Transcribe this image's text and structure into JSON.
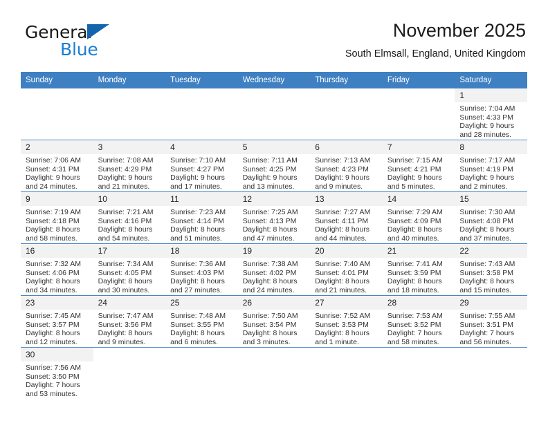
{
  "logo": {
    "word1": "General",
    "word2": "Blue",
    "triangle_color": "#1565ad",
    "blue_color": "#1a7fd4"
  },
  "header": {
    "title": "November 2025",
    "subtitle": "South Elmsall, England, United Kingdom"
  },
  "colors": {
    "header_bar": "#3f80c2",
    "row_divider": "#4a86c5",
    "daynum_bg": "#f2f2f2"
  },
  "weekday_headers": [
    "Sunday",
    "Monday",
    "Tuesday",
    "Wednesday",
    "Thursday",
    "Friday",
    "Saturday"
  ],
  "weeks": [
    [
      {
        "blank": true
      },
      {
        "blank": true
      },
      {
        "blank": true
      },
      {
        "blank": true
      },
      {
        "blank": true
      },
      {
        "blank": true
      },
      {
        "day": "1",
        "sunrise": "Sunrise: 7:04 AM",
        "sunset": "Sunset: 4:33 PM",
        "daylight1": "Daylight: 9 hours",
        "daylight2": "and 28 minutes."
      }
    ],
    [
      {
        "day": "2",
        "sunrise": "Sunrise: 7:06 AM",
        "sunset": "Sunset: 4:31 PM",
        "daylight1": "Daylight: 9 hours",
        "daylight2": "and 24 minutes."
      },
      {
        "day": "3",
        "sunrise": "Sunrise: 7:08 AM",
        "sunset": "Sunset: 4:29 PM",
        "daylight1": "Daylight: 9 hours",
        "daylight2": "and 21 minutes."
      },
      {
        "day": "4",
        "sunrise": "Sunrise: 7:10 AM",
        "sunset": "Sunset: 4:27 PM",
        "daylight1": "Daylight: 9 hours",
        "daylight2": "and 17 minutes."
      },
      {
        "day": "5",
        "sunrise": "Sunrise: 7:11 AM",
        "sunset": "Sunset: 4:25 PM",
        "daylight1": "Daylight: 9 hours",
        "daylight2": "and 13 minutes."
      },
      {
        "day": "6",
        "sunrise": "Sunrise: 7:13 AM",
        "sunset": "Sunset: 4:23 PM",
        "daylight1": "Daylight: 9 hours",
        "daylight2": "and 9 minutes."
      },
      {
        "day": "7",
        "sunrise": "Sunrise: 7:15 AM",
        "sunset": "Sunset: 4:21 PM",
        "daylight1": "Daylight: 9 hours",
        "daylight2": "and 5 minutes."
      },
      {
        "day": "8",
        "sunrise": "Sunrise: 7:17 AM",
        "sunset": "Sunset: 4:19 PM",
        "daylight1": "Daylight: 9 hours",
        "daylight2": "and 2 minutes."
      }
    ],
    [
      {
        "day": "9",
        "sunrise": "Sunrise: 7:19 AM",
        "sunset": "Sunset: 4:18 PM",
        "daylight1": "Daylight: 8 hours",
        "daylight2": "and 58 minutes."
      },
      {
        "day": "10",
        "sunrise": "Sunrise: 7:21 AM",
        "sunset": "Sunset: 4:16 PM",
        "daylight1": "Daylight: 8 hours",
        "daylight2": "and 54 minutes."
      },
      {
        "day": "11",
        "sunrise": "Sunrise: 7:23 AM",
        "sunset": "Sunset: 4:14 PM",
        "daylight1": "Daylight: 8 hours",
        "daylight2": "and 51 minutes."
      },
      {
        "day": "12",
        "sunrise": "Sunrise: 7:25 AM",
        "sunset": "Sunset: 4:13 PM",
        "daylight1": "Daylight: 8 hours",
        "daylight2": "and 47 minutes."
      },
      {
        "day": "13",
        "sunrise": "Sunrise: 7:27 AM",
        "sunset": "Sunset: 4:11 PM",
        "daylight1": "Daylight: 8 hours",
        "daylight2": "and 44 minutes."
      },
      {
        "day": "14",
        "sunrise": "Sunrise: 7:29 AM",
        "sunset": "Sunset: 4:09 PM",
        "daylight1": "Daylight: 8 hours",
        "daylight2": "and 40 minutes."
      },
      {
        "day": "15",
        "sunrise": "Sunrise: 7:30 AM",
        "sunset": "Sunset: 4:08 PM",
        "daylight1": "Daylight: 8 hours",
        "daylight2": "and 37 minutes."
      }
    ],
    [
      {
        "day": "16",
        "sunrise": "Sunrise: 7:32 AM",
        "sunset": "Sunset: 4:06 PM",
        "daylight1": "Daylight: 8 hours",
        "daylight2": "and 34 minutes."
      },
      {
        "day": "17",
        "sunrise": "Sunrise: 7:34 AM",
        "sunset": "Sunset: 4:05 PM",
        "daylight1": "Daylight: 8 hours",
        "daylight2": "and 30 minutes."
      },
      {
        "day": "18",
        "sunrise": "Sunrise: 7:36 AM",
        "sunset": "Sunset: 4:03 PM",
        "daylight1": "Daylight: 8 hours",
        "daylight2": "and 27 minutes."
      },
      {
        "day": "19",
        "sunrise": "Sunrise: 7:38 AM",
        "sunset": "Sunset: 4:02 PM",
        "daylight1": "Daylight: 8 hours",
        "daylight2": "and 24 minutes."
      },
      {
        "day": "20",
        "sunrise": "Sunrise: 7:40 AM",
        "sunset": "Sunset: 4:01 PM",
        "daylight1": "Daylight: 8 hours",
        "daylight2": "and 21 minutes."
      },
      {
        "day": "21",
        "sunrise": "Sunrise: 7:41 AM",
        "sunset": "Sunset: 3:59 PM",
        "daylight1": "Daylight: 8 hours",
        "daylight2": "and 18 minutes."
      },
      {
        "day": "22",
        "sunrise": "Sunrise: 7:43 AM",
        "sunset": "Sunset: 3:58 PM",
        "daylight1": "Daylight: 8 hours",
        "daylight2": "and 15 minutes."
      }
    ],
    [
      {
        "day": "23",
        "sunrise": "Sunrise: 7:45 AM",
        "sunset": "Sunset: 3:57 PM",
        "daylight1": "Daylight: 8 hours",
        "daylight2": "and 12 minutes."
      },
      {
        "day": "24",
        "sunrise": "Sunrise: 7:47 AM",
        "sunset": "Sunset: 3:56 PM",
        "daylight1": "Daylight: 8 hours",
        "daylight2": "and 9 minutes."
      },
      {
        "day": "25",
        "sunrise": "Sunrise: 7:48 AM",
        "sunset": "Sunset: 3:55 PM",
        "daylight1": "Daylight: 8 hours",
        "daylight2": "and 6 minutes."
      },
      {
        "day": "26",
        "sunrise": "Sunrise: 7:50 AM",
        "sunset": "Sunset: 3:54 PM",
        "daylight1": "Daylight: 8 hours",
        "daylight2": "and 3 minutes."
      },
      {
        "day": "27",
        "sunrise": "Sunrise: 7:52 AM",
        "sunset": "Sunset: 3:53 PM",
        "daylight1": "Daylight: 8 hours",
        "daylight2": "and 1 minute."
      },
      {
        "day": "28",
        "sunrise": "Sunrise: 7:53 AM",
        "sunset": "Sunset: 3:52 PM",
        "daylight1": "Daylight: 7 hours",
        "daylight2": "and 58 minutes."
      },
      {
        "day": "29",
        "sunrise": "Sunrise: 7:55 AM",
        "sunset": "Sunset: 3:51 PM",
        "daylight1": "Daylight: 7 hours",
        "daylight2": "and 56 minutes."
      }
    ],
    [
      {
        "day": "30",
        "sunrise": "Sunrise: 7:56 AM",
        "sunset": "Sunset: 3:50 PM",
        "daylight1": "Daylight: 7 hours",
        "daylight2": "and 53 minutes."
      },
      {
        "blank": true
      },
      {
        "blank": true
      },
      {
        "blank": true
      },
      {
        "blank": true
      },
      {
        "blank": true
      },
      {
        "blank": true
      }
    ]
  ]
}
